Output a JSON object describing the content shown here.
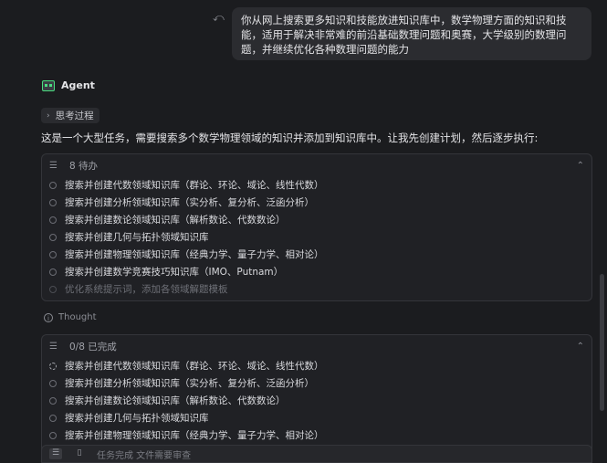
{
  "user_message": "你从网上搜索更多知识和技能放进知识库中，数学物理方面的知识和技能，适用于解决非常难的前沿基础数理问题和奥赛，大学级别的数理问题，并继续优化各种数理问题的能力",
  "agent": {
    "name": "Agent"
  },
  "thinking_label": "思考过程",
  "intro_text": "这是一个大型任务，需要搜索多个数学物理领域的知识并添加到知识库中。让我先创建计划，然后逐步执行:",
  "todo_panel_1": {
    "header": "8 待办",
    "items": [
      "搜索并创建代数领域知识库（群论、环论、域论、线性代数）",
      "搜索并创建分析领域知识库（实分析、复分析、泛函分析）",
      "搜索并创建数论领域知识库（解析数论、代数数论）",
      "搜索并创建几何与拓扑领域知识库",
      "搜索并创建物理领域知识库（经典力学、量子力学、相对论）",
      "搜索并创建数学竞赛技巧知识库（IMO、Putnam）",
      "优化系统提示词，添加各领域解题模板"
    ]
  },
  "thought_label": "Thought",
  "todo_panel_2": {
    "header": "0/8 已完成",
    "items": [
      "搜索并创建代数领域知识库（群论、环论、域论、线性代数）",
      "搜索并创建分析领域知识库（实分析、复分析、泛函分析）",
      "搜索并创建数论领域知识库（解析数论、代数数论）",
      "搜索并创建几何与拓扑领域知识库",
      "搜索并创建物理领域知识库（经典力学、量子力学、相对论）"
    ]
  },
  "bottom_status": "任务完成  文件需要审查"
}
